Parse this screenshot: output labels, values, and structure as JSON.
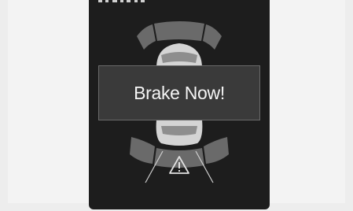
{
  "display": {
    "banner_text": "Brake Now!",
    "warning_icon": "warning-triangle-icon",
    "colors": {
      "screen": "#1d1d1d",
      "banner": "#3a3a3a",
      "sensor_zone": "#6a6a6a",
      "car": "#d8d8d8"
    }
  }
}
